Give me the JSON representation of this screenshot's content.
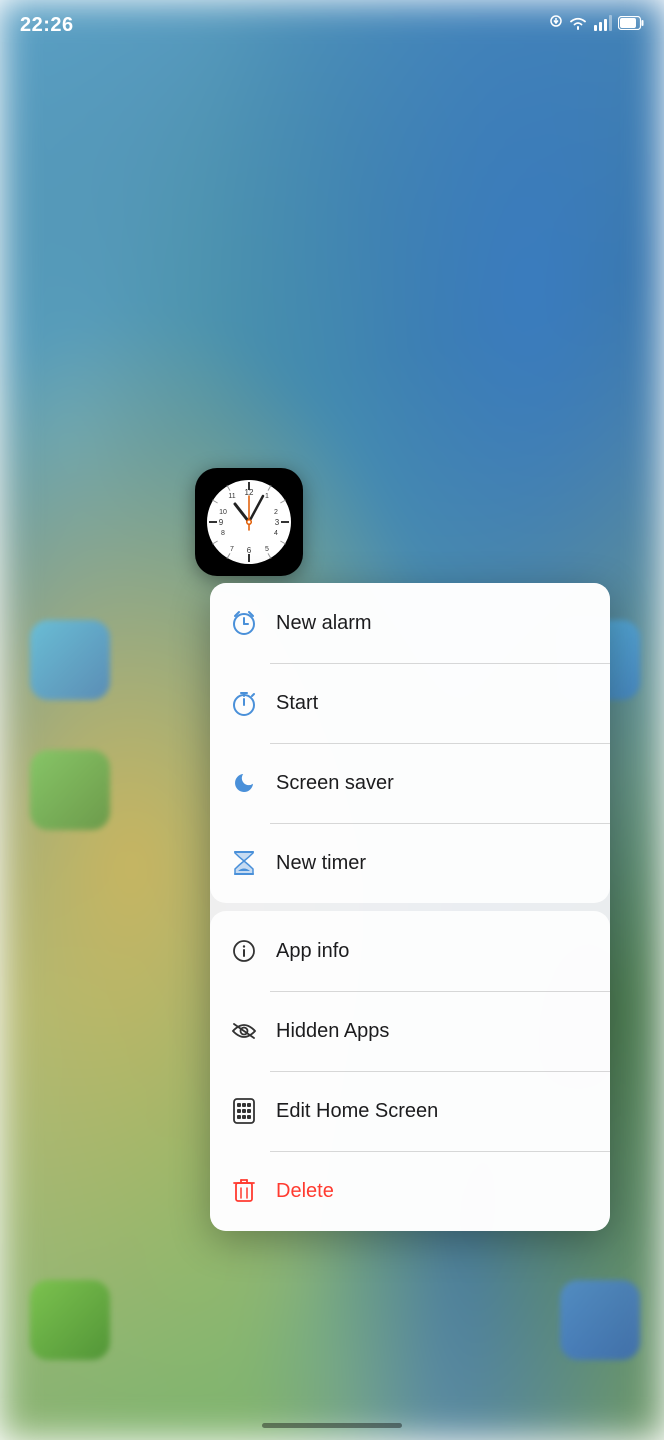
{
  "statusBar": {
    "time": "22:26",
    "icons": {
      "download": "↓",
      "wifi": "wifi",
      "signal": "signal",
      "battery": "battery"
    }
  },
  "clockIcon": {
    "label": "Clock"
  },
  "contextMenu": {
    "sections": [
      {
        "id": "shortcuts",
        "items": [
          {
            "id": "new-alarm",
            "label": "New alarm",
            "icon": "alarm"
          },
          {
            "id": "start",
            "label": "Start",
            "icon": "stopwatch"
          },
          {
            "id": "screen-saver",
            "label": "Screen saver",
            "icon": "moon"
          },
          {
            "id": "new-timer",
            "label": "New timer",
            "icon": "hourglass"
          }
        ]
      },
      {
        "id": "actions",
        "items": [
          {
            "id": "app-info",
            "label": "App info",
            "icon": "info"
          },
          {
            "id": "hidden-apps",
            "label": "Hidden Apps",
            "icon": "eye-slash"
          },
          {
            "id": "edit-home-screen",
            "label": "Edit Home Screen",
            "icon": "phone-grid"
          },
          {
            "id": "delete",
            "label": "Delete",
            "icon": "trash",
            "style": "red"
          }
        ]
      }
    ]
  },
  "homeIndicator": {}
}
